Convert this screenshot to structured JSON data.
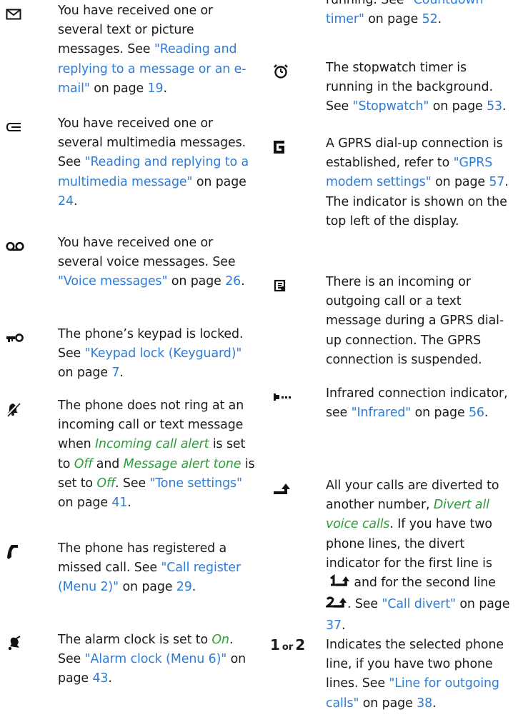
{
  "left_column": {
    "entries": [
      {
        "icon": "envelope-icon",
        "text": "You have received one or several text or picture messages. See ",
        "link": "\"Reading and replying to a message or an e-mail\"",
        "after": " on page ",
        "page": "19",
        "end": "."
      },
      {
        "icon": "multimedia-message-icon",
        "text": "You have received one or several multimedia messages. See ",
        "link": "\"Reading and replying to a multimedia message\"",
        "after": " on page ",
        "page": "24",
        "end": "."
      },
      {
        "icon": "voicemail-icon",
        "text": "You have received one or several voice messages. See ",
        "link": "\"Voice messages\"",
        "after": " on page ",
        "page": "26",
        "end": "."
      },
      {
        "icon": "key-icon",
        "text": "The phone’s keypad is locked. See ",
        "link": "\"Keypad lock (Keyguard)\"",
        "after": " on page ",
        "page": "7",
        "end": "."
      },
      {
        "icon": "silent-mode-icon",
        "p1": "The phone does not ring at an incoming call or text message when ",
        "em1": "Incoming call alert",
        "p2": " is set to ",
        "em2": "Off",
        "p3": " and ",
        "em3": "Message alert tone",
        "p4": " is set to ",
        "em4": "Off",
        "p5": ". See ",
        "link": "\"Tone settings\"",
        "after": " on page ",
        "page": "41",
        "end": "."
      },
      {
        "icon": "missed-call-icon",
        "text": "The phone has registered a missed call. See ",
        "link": "\"Call register (Menu 2)\"",
        "after": " on page ",
        "page": "29",
        "end": "."
      },
      {
        "icon": "alarm-bell-icon",
        "p1": "The alarm clock is set to ",
        "em1": "On",
        "p2": ". See ",
        "link": "\"Alarm clock (Menu 6)\"",
        "after": " on page ",
        "page": "43",
        "end": "."
      }
    ]
  },
  "right_column": {
    "top_fragment": {
      "text": "running. See ",
      "link": "\"Countdown timer\"",
      "after": " on page ",
      "page": "52",
      "end": "."
    },
    "entries": [
      {
        "icon": "stopwatch-icon",
        "text": "The stopwatch timer is running in the background. See ",
        "link": "\"Stopwatch\"",
        "after": " on page ",
        "page": "53",
        "end": "."
      },
      {
        "icon": "gprs-g-icon",
        "text": "A GPRS dial-up connection is established, refer to ",
        "link": "\"GPRS modem settings\"",
        "after": " on page ",
        "page": "57",
        "end": ". The indicator is shown on the top left of the display."
      },
      {
        "icon": "gprs-suspended-icon",
        "text": "There is an incoming or outgoing call or a text message during a GPRS dial-up connection. The GPRS connection is suspended."
      },
      {
        "icon": "infrared-icon",
        "text": "Infrared connection indicator, see ",
        "link": "\"Infrared\"",
        "after": " on page ",
        "page": "56",
        "end": "."
      },
      {
        "icon": "call-divert-icon",
        "p1": "All your calls are diverted to another number, ",
        "em1": "Divert all voice calls",
        "p2": ". If you have two phone lines, the divert indicator for the first line is ",
        "p3": " and for the second line ",
        "p4": ". See ",
        "link": "\"Call divert\"",
        "after": " on page ",
        "page": "37",
        "end": "."
      },
      {
        "index_one": "1",
        "index_or": "or",
        "index_two": "2",
        "text": "Indicates the selected phone line, if you have two phone lines. See ",
        "link": "\"Line for outgoing calls\"",
        "after": " on page ",
        "page": "38",
        "end": "."
      }
    ]
  },
  "colors": {
    "link": "#2f7cd6",
    "emphasis": "#2e9d3c",
    "text": "#1a1a1a"
  }
}
